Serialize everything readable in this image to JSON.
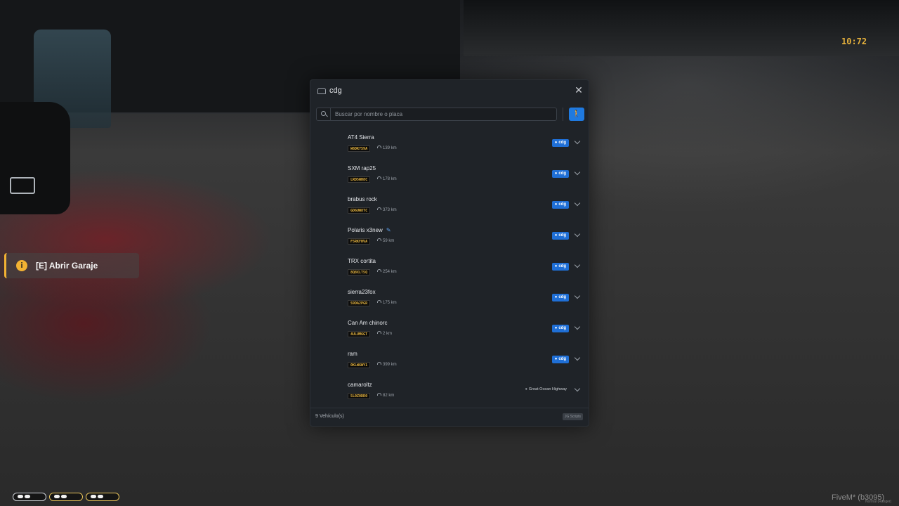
{
  "hud": {
    "timer": "10:72",
    "prompt_key_label": "[E] Abrir Garaje",
    "watermark": "FiveM* (b3095)",
    "watermark_sub": "Normal (Ranger)"
  },
  "garage": {
    "title": "cdg",
    "search_placeholder": "Buscar por nombre o placa",
    "vehicles": [
      {
        "name": "AT4 Sierra",
        "plate": "W6DK7S9A",
        "km": "139 km",
        "badge": "cdg"
      },
      {
        "name": "SXM rap25",
        "plate": "LRD5WH8C",
        "km": "178 km",
        "badge": "cdg"
      },
      {
        "name": "brabus rock",
        "plate": "GD6UW8TC",
        "km": "373 km",
        "badge": "cdg"
      },
      {
        "name": "Polaris x3new",
        "plate": "F5RKFHVA",
        "km": "59 km",
        "badge": "cdg",
        "editable": true
      },
      {
        "name": "TRX cortita",
        "plate": "8Q8XLT5Q",
        "km": "254 km",
        "badge": "cdg"
      },
      {
        "name": "sierra23fox",
        "plate": "S9DA2PGR",
        "km": "175 km",
        "badge": "cdg"
      },
      {
        "name": "Can Am chinorc",
        "plate": "4ULUM6GT",
        "km": "2 km",
        "badge": "cdg"
      },
      {
        "name": "ram",
        "plate": "0KLW6WY1",
        "km": "399 km",
        "badge": "cdg"
      },
      {
        "name": "camaroltz",
        "plate": "5L0Z0DR0",
        "km": "82 km",
        "location": "Great Ocean Highway"
      }
    ],
    "footer_count": "9 Vehículo(s)",
    "footer_brand": "JG Scripts"
  },
  "colors": {
    "accent_blue": "#1f7ae0",
    "plate_text": "#e8b640",
    "prompt_accent": "#f2b233"
  },
  "icons": {
    "header": "car-icon",
    "search": "search-icon",
    "close": "close-icon",
    "walk": "person-walking-icon",
    "row_expand": "chevron-down-icon",
    "mileage": "speedometer-icon",
    "location": "map-pin-icon"
  }
}
